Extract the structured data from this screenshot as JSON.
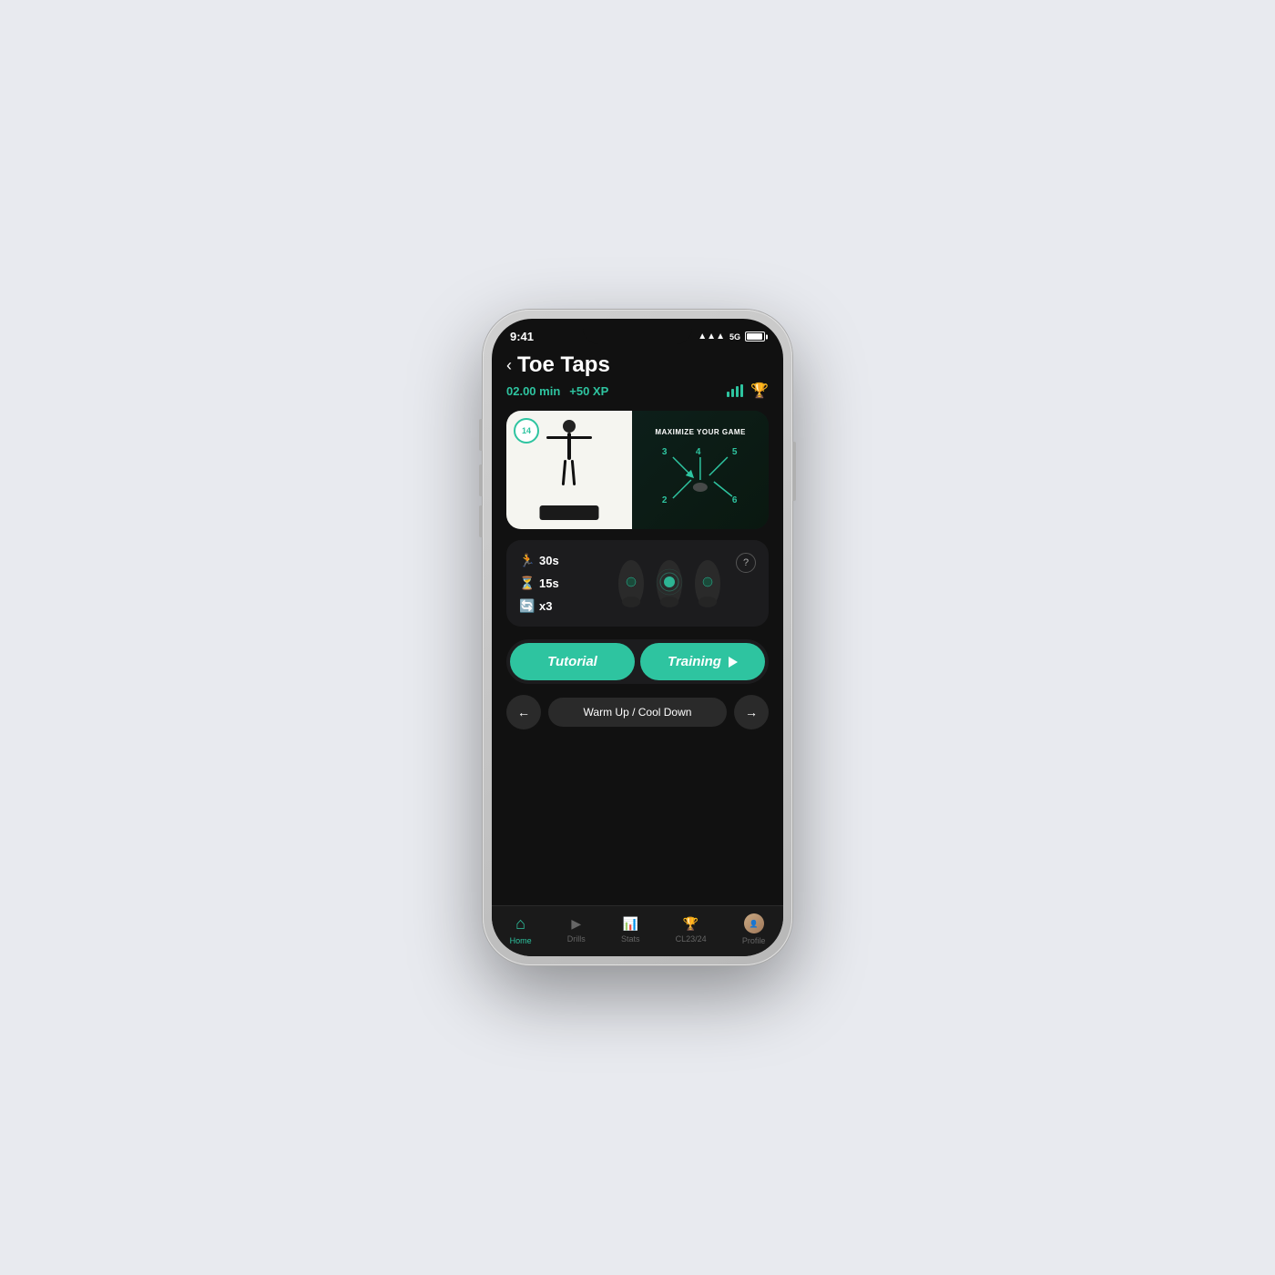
{
  "status": {
    "time": "9:41",
    "signal": "5G",
    "battery": "full"
  },
  "header": {
    "back_label": "‹",
    "title": "Toe Taps",
    "time": "02.00 min",
    "xp": "+50 XP",
    "speed_bars": [
      8,
      11,
      14,
      16
    ],
    "trophy": "🏆"
  },
  "video": {
    "timer_count": "14",
    "right_title": "MAXIMIZE YOUR GAME",
    "grid_numbers": [
      "3",
      "4",
      "5",
      "2",
      "",
      "6"
    ]
  },
  "exercise": {
    "duration_icon": "🏃",
    "duration_value": "30s",
    "rest_icon": "⏳",
    "rest_value": "15s",
    "rounds_icon": "🔄",
    "rounds_value": "x3",
    "help_label": "?",
    "feet": [
      {
        "position": "left",
        "active": false
      },
      {
        "position": "center",
        "active": true
      },
      {
        "position": "right",
        "active": false
      }
    ]
  },
  "actions": {
    "tutorial_label": "Tutorial",
    "training_label": "Training"
  },
  "nav_pills": {
    "prev_arrow": "←",
    "label": "Warm Up / Cool Down",
    "next_arrow": "→"
  },
  "bottom_nav": {
    "items": [
      {
        "id": "home",
        "label": "Home",
        "active": true
      },
      {
        "id": "drills",
        "label": "Drills",
        "active": false
      },
      {
        "id": "stats",
        "label": "Stats",
        "active": false
      },
      {
        "id": "cl",
        "label": "CL23/24",
        "active": false
      },
      {
        "id": "profile",
        "label": "Profile",
        "active": false
      }
    ]
  }
}
